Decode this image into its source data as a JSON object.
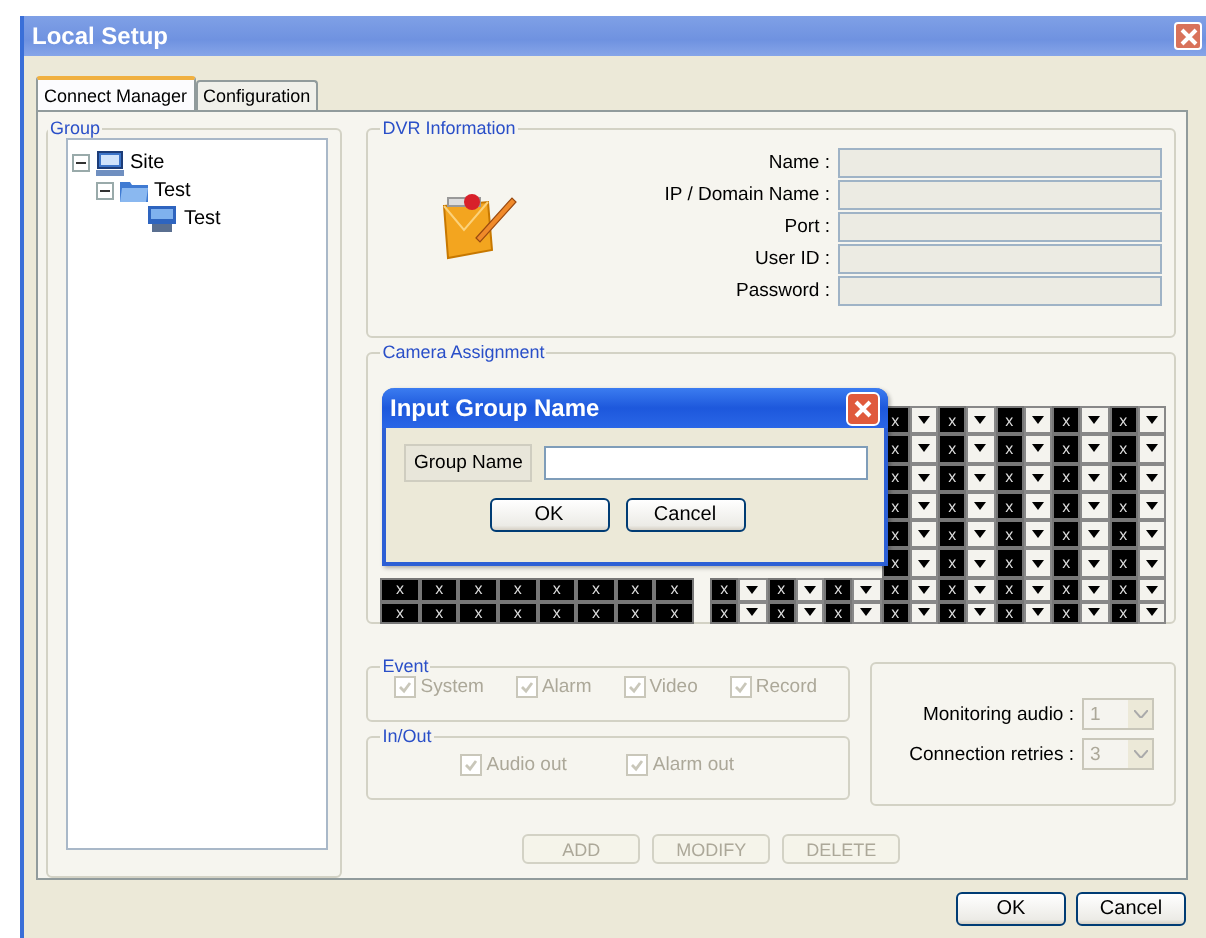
{
  "window": {
    "title": "Local Setup"
  },
  "tabs": [
    {
      "label": "Connect Manager",
      "selected": true
    },
    {
      "label": "Configuration",
      "selected": false
    }
  ],
  "group": {
    "title": "Group",
    "tree": [
      {
        "label": "Site",
        "kind": "site",
        "expanded": true,
        "children": [
          {
            "label": "Test",
            "kind": "folder",
            "expanded": true,
            "children": [
              {
                "label": "Test",
                "kind": "dvr"
              }
            ]
          }
        ]
      }
    ]
  },
  "dvr_information": {
    "title": "DVR Information",
    "fields": [
      {
        "label": "Name :",
        "disabled": true
      },
      {
        "label": "IP / Domain Name :",
        "disabled": true
      },
      {
        "label": "Port :",
        "disabled": true
      },
      {
        "label": "User ID :",
        "disabled": true
      },
      {
        "label": "Password :",
        "disabled": true
      }
    ]
  },
  "camera_assignment": {
    "title": "Camera Assignment",
    "client_rows": [
      null,
      null,
      null,
      null,
      null,
      null,
      [
        "x",
        "x",
        "x",
        "x",
        "x",
        "x",
        "x",
        "x"
      ],
      [
        "x",
        "x",
        "x",
        "x",
        "x",
        "x",
        "x",
        "x"
      ]
    ],
    "dvr_rows": [
      [
        null,
        null,
        null,
        "x",
        "x",
        "x",
        "x",
        "x"
      ],
      [
        null,
        null,
        null,
        "x",
        "x",
        "x",
        "x",
        "x"
      ],
      [
        null,
        null,
        null,
        "x",
        "x",
        "x",
        "x",
        "x"
      ],
      [
        null,
        null,
        null,
        "x",
        "x",
        "x",
        "x",
        "x"
      ],
      [
        null,
        null,
        null,
        "x",
        "x",
        "x",
        "x",
        "x"
      ],
      [
        null,
        null,
        null,
        "x",
        "x",
        "x",
        "x",
        "x"
      ],
      [
        "x",
        "x",
        "x",
        "x",
        "x",
        "x",
        "x",
        "x"
      ],
      [
        "x",
        "x",
        "x",
        "x",
        "x",
        "x",
        "x",
        "x"
      ]
    ]
  },
  "event": {
    "title": "Event",
    "options": [
      {
        "label": "System",
        "checked": true,
        "disabled": true
      },
      {
        "label": "Alarm",
        "checked": true,
        "disabled": true
      },
      {
        "label": "Video",
        "checked": true,
        "disabled": true
      },
      {
        "label": "Record",
        "checked": true,
        "disabled": true
      }
    ]
  },
  "in_out": {
    "title": "In/Out",
    "options": [
      {
        "label": "Audio out",
        "checked": true,
        "disabled": true
      },
      {
        "label": "Alarm out",
        "checked": true,
        "disabled": true
      }
    ]
  },
  "settings": [
    {
      "label": "Monitoring audio :",
      "value": "1",
      "disabled": true
    },
    {
      "label": "Connection retries :",
      "value": "3",
      "disabled": true
    }
  ],
  "actions": [
    {
      "label": "ADD",
      "disabled": true
    },
    {
      "label": "MODIFY",
      "disabled": true
    },
    {
      "label": "DELETE",
      "disabled": true
    }
  ],
  "footer_buttons": [
    "OK",
    "Cancel"
  ],
  "dialog": {
    "title": "Input Group Name",
    "field_label": "Group Name",
    "buttons": [
      "OK",
      "Cancel"
    ]
  }
}
